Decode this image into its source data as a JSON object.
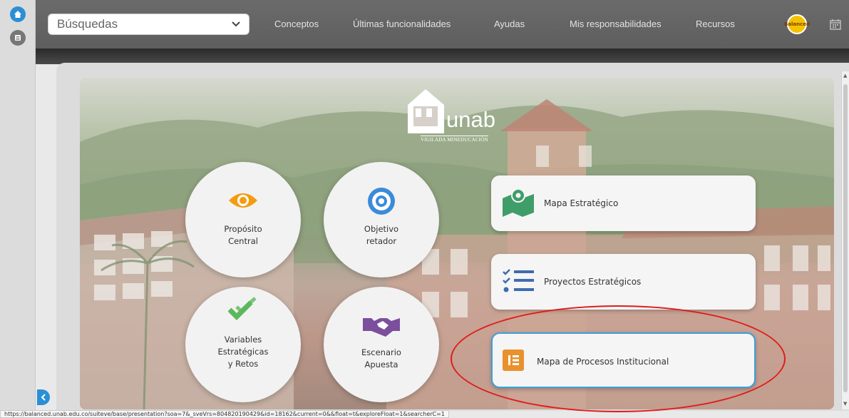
{
  "header": {
    "search_value": "Búsquedas",
    "nav": [
      "Conceptos",
      "Últimas funcionalidades",
      "Ayudas",
      "Mis responsabilidades",
      "Recursos"
    ],
    "avatar_text": "Balanced"
  },
  "logo": {
    "name": "unab",
    "tagline": "VIGILADA MINEDUCACIÓN"
  },
  "circles": [
    {
      "label": "Propósito\nCentral",
      "icon": "eye-icon",
      "color": "#f39c12"
    },
    {
      "label": "Objetivo\nretador",
      "icon": "target-icon",
      "color": "#3b8bd9"
    },
    {
      "label": "Variables\nEstratégicas\ny Retos",
      "icon": "checkmark-icon",
      "color": "#5cb85c"
    },
    {
      "label": "Escenario\nApuesta",
      "icon": "handshake-icon",
      "color": "#7b4f9d"
    }
  ],
  "cards": [
    {
      "label": "Mapa Estratégico",
      "icon": "map-pin-icon",
      "color": "#3f9d6a"
    },
    {
      "label": "Proyectos Estratégicos",
      "icon": "checklist-icon",
      "color": "#3f6bb0"
    },
    {
      "label": "Mapa de Procesos Institucional",
      "icon": "process-map-icon",
      "color": "#e8912d",
      "active": true
    }
  ],
  "status_url": "https://balanced.unab.edu.co/suiteve/base/presentation?soa=7&_sveVrs=804820190429&id=18162&current=0&&float=t&exploreFloat=1&searcherC=1"
}
